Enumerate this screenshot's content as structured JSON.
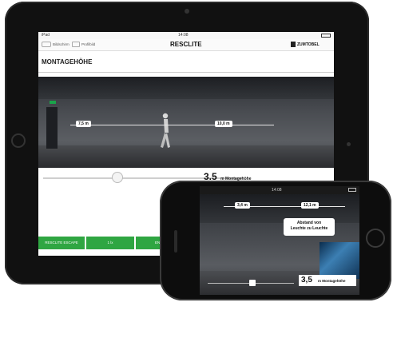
{
  "ipad": {
    "status_left": "iPad",
    "status_center": "14:08",
    "nav_back_label": "Bildschirm",
    "nav_item_label": "Profilbild",
    "app_title": "RESCLITE",
    "brand": "ZUMTOBEL",
    "page_title": "MONTAGEHÖHE",
    "dim_left": "7,5 m",
    "dim_right": "10,0 m",
    "height_value": "3.5",
    "height_unit_label": "m Montagehöhe",
    "tabs": [
      {
        "label": "RESCLITE ESCAPE"
      },
      {
        "label": "1 lx"
      },
      {
        "label": "EN 1"
      }
    ]
  },
  "iphone": {
    "status_center": "14:08",
    "dim_left": "3,4 m",
    "dim_right": "12,1 m",
    "callout_line1": "Abstand von",
    "callout_line2": "Leuchte zu Leuchte",
    "height_value": "3,5",
    "height_unit_label": "m  Montagehöhe"
  },
  "colors": {
    "accent_green": "#2fa642",
    "exit_sign": "#1aa34a"
  },
  "slider": {
    "ipad_level_fraction": 0.37,
    "iphone_level_fraction": 0.52
  }
}
